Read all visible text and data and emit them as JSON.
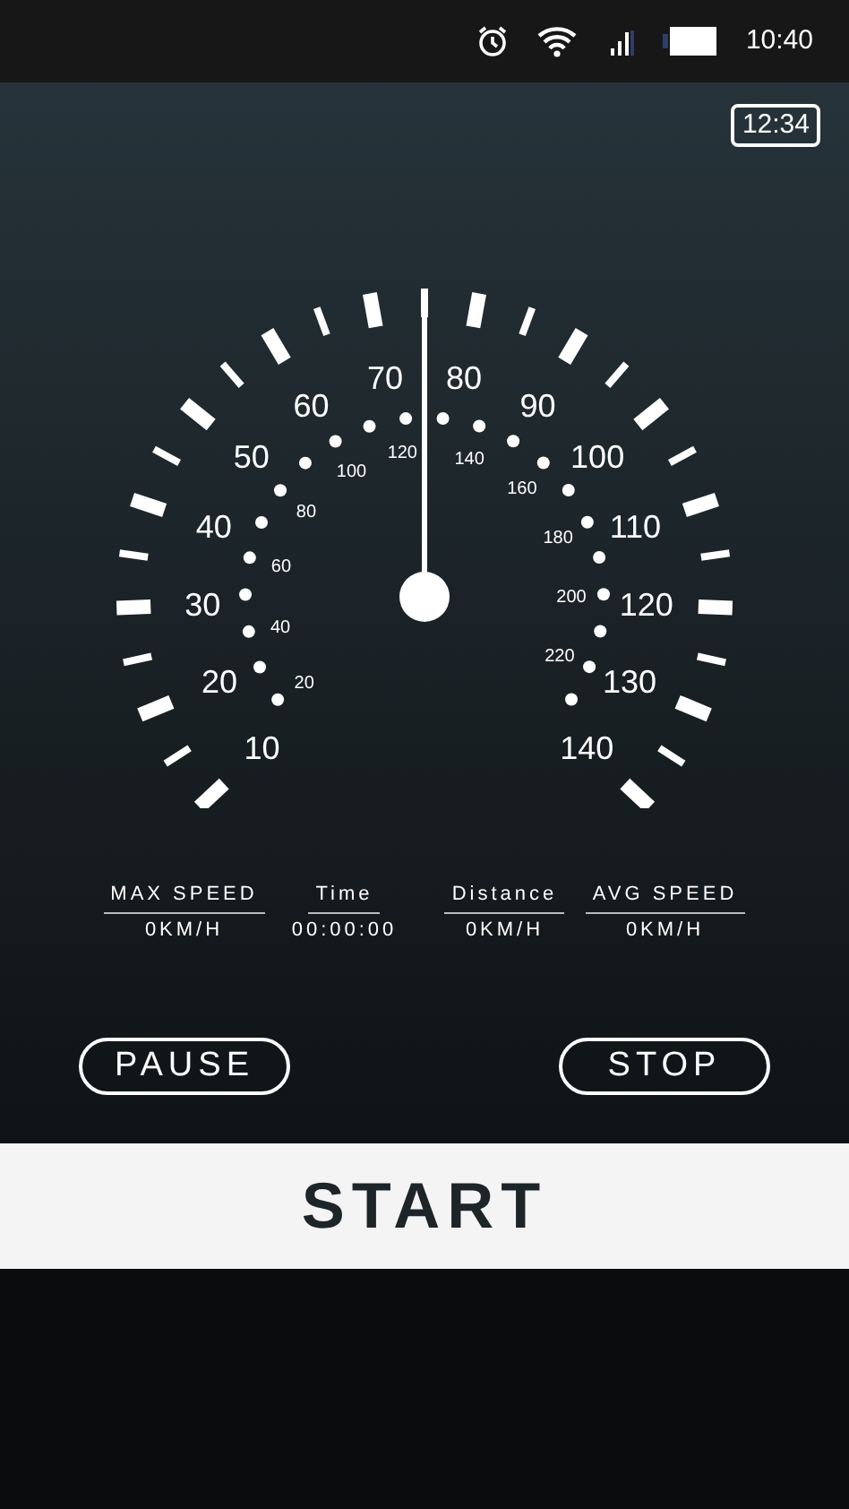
{
  "status_bar": {
    "time": "10:40"
  },
  "clock_badge": {
    "text": "12:34"
  },
  "gauge": {
    "outer_labels": [
      "10",
      "20",
      "30",
      "40",
      "50",
      "60",
      "70",
      "80",
      "90",
      "100",
      "110",
      "120",
      "130",
      "140"
    ],
    "inner_labels": [
      "20",
      "40",
      "60",
      "80",
      "100",
      "120",
      "140",
      "160",
      "180",
      "200",
      "220"
    ]
  },
  "stats": [
    {
      "label": "MAX SPEED",
      "value": "0KM/H"
    },
    {
      "label": "Time",
      "value": "00:00:00"
    },
    {
      "label": "Distance",
      "value": "0KM/H"
    },
    {
      "label": "AVG SPEED",
      "value": "0KM/H"
    }
  ],
  "buttons": {
    "pause": "PAUSE",
    "stop": "STOP",
    "start": "START"
  }
}
